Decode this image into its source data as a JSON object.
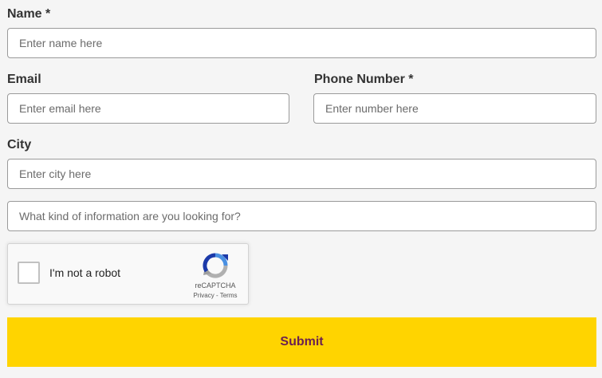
{
  "form": {
    "name": {
      "label": "Name *",
      "placeholder": "Enter name here",
      "value": ""
    },
    "email": {
      "label": "Email",
      "placeholder": "Enter email here",
      "value": ""
    },
    "phone": {
      "label": "Phone Number *",
      "placeholder": "Enter number here",
      "value": ""
    },
    "city": {
      "label": "City",
      "placeholder": "Enter city here",
      "value": ""
    },
    "info": {
      "placeholder": "What kind of information are you looking for?",
      "value": ""
    },
    "recaptcha": {
      "label": "I'm not a robot",
      "brand": "reCAPTCHA",
      "privacy": "Privacy",
      "separator": " - ",
      "terms": "Terms",
      "checked": false
    },
    "submit_label": "Submit"
  },
  "colors": {
    "background": "#f5f5f5",
    "submit_bg": "#ffd400",
    "submit_text": "#6b2151",
    "label_text": "#333333"
  },
  "icons": {
    "recaptcha": "recaptcha-logo-icon"
  }
}
